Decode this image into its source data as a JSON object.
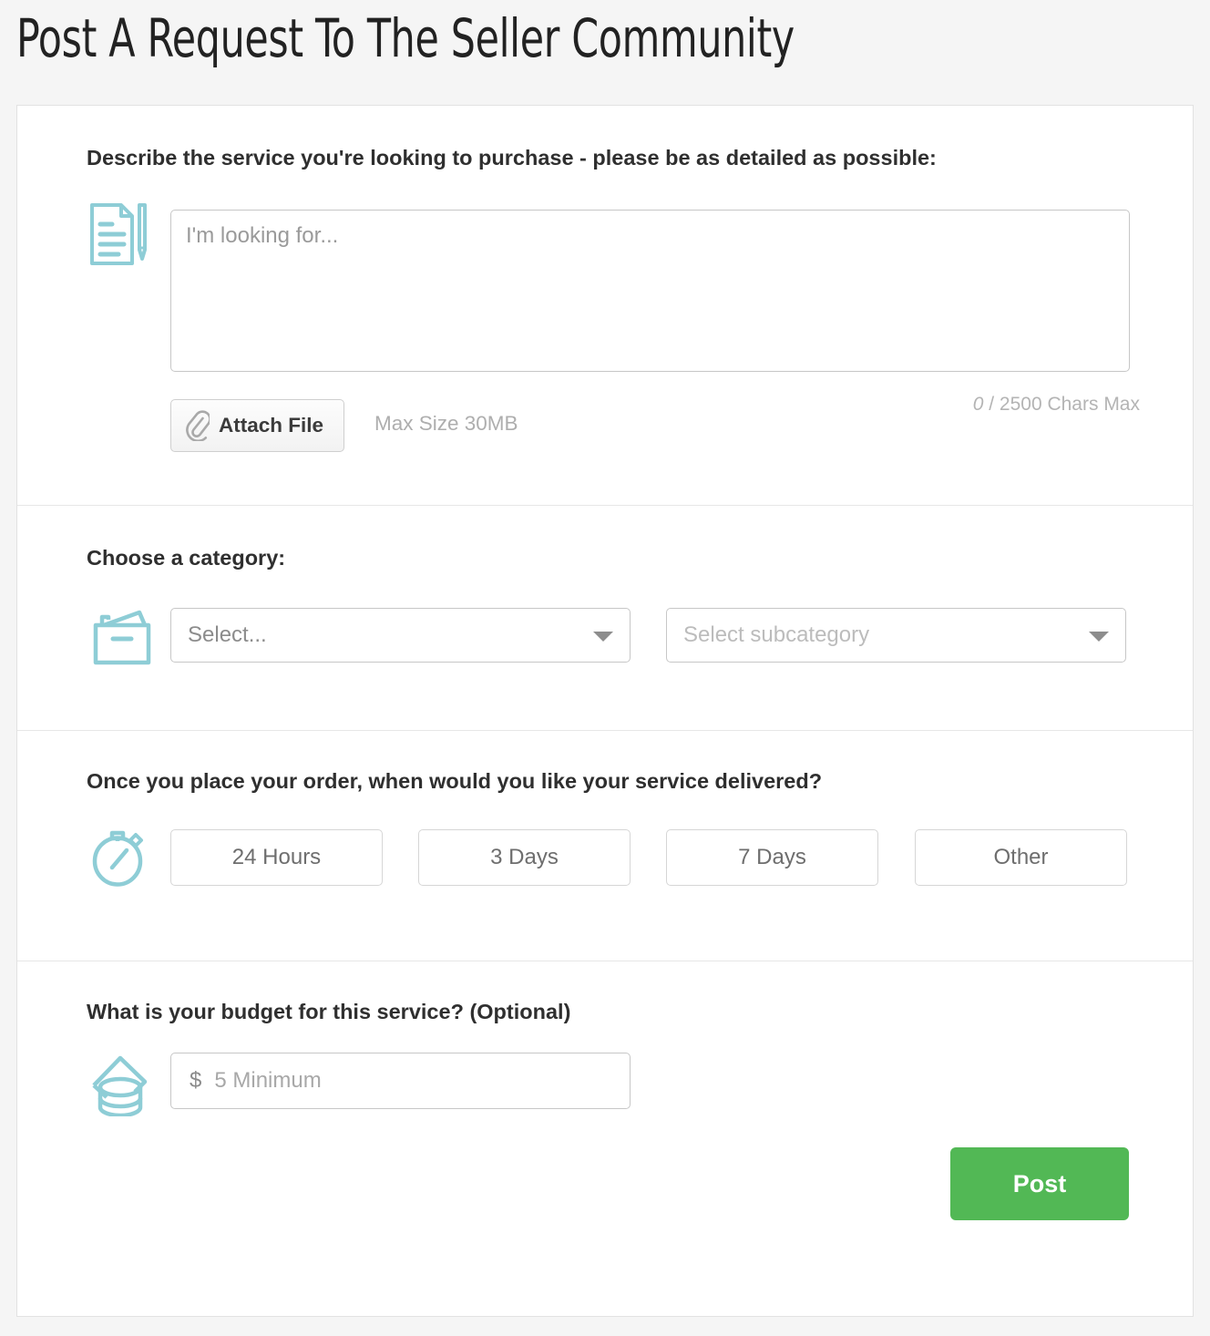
{
  "page": {
    "title": "Post A Request To The Seller Community",
    "background_color": "#f5f5f5",
    "accent_icon_color": "#8ecdd6",
    "post_button_color": "#52b855"
  },
  "describe_section": {
    "label": "Describe the service you're looking to purchase - please be as detailed as possible:",
    "icon": "document-pencil-icon",
    "textarea_value": "",
    "textarea_placeholder": "I'm looking for...",
    "attach_button_label": "Attach File",
    "attach_icon": "paperclip-icon",
    "max_size_note": "Max Size 30MB",
    "char_count_current": "0",
    "char_count_suffix": " / 2500 Chars Max"
  },
  "category_section": {
    "label": "Choose a category:",
    "icon": "file-box-icon",
    "category_select_value": "Select...",
    "subcategory_select_value": "Select subcategory",
    "caret_icon": "chevron-down-icon"
  },
  "delivery_section": {
    "label": "Once you place your order, when would you like your service delivered?",
    "icon": "stopwatch-icon",
    "options": [
      {
        "label": "24 Hours"
      },
      {
        "label": "3 Days"
      },
      {
        "label": "7 Days"
      },
      {
        "label": "Other"
      }
    ]
  },
  "budget_section": {
    "label": "What is your budget for this service? (Optional)",
    "icon": "coins-icon",
    "currency_symbol": "$",
    "budget_value": "",
    "budget_placeholder": "5 Minimum",
    "post_button_label": "Post"
  }
}
